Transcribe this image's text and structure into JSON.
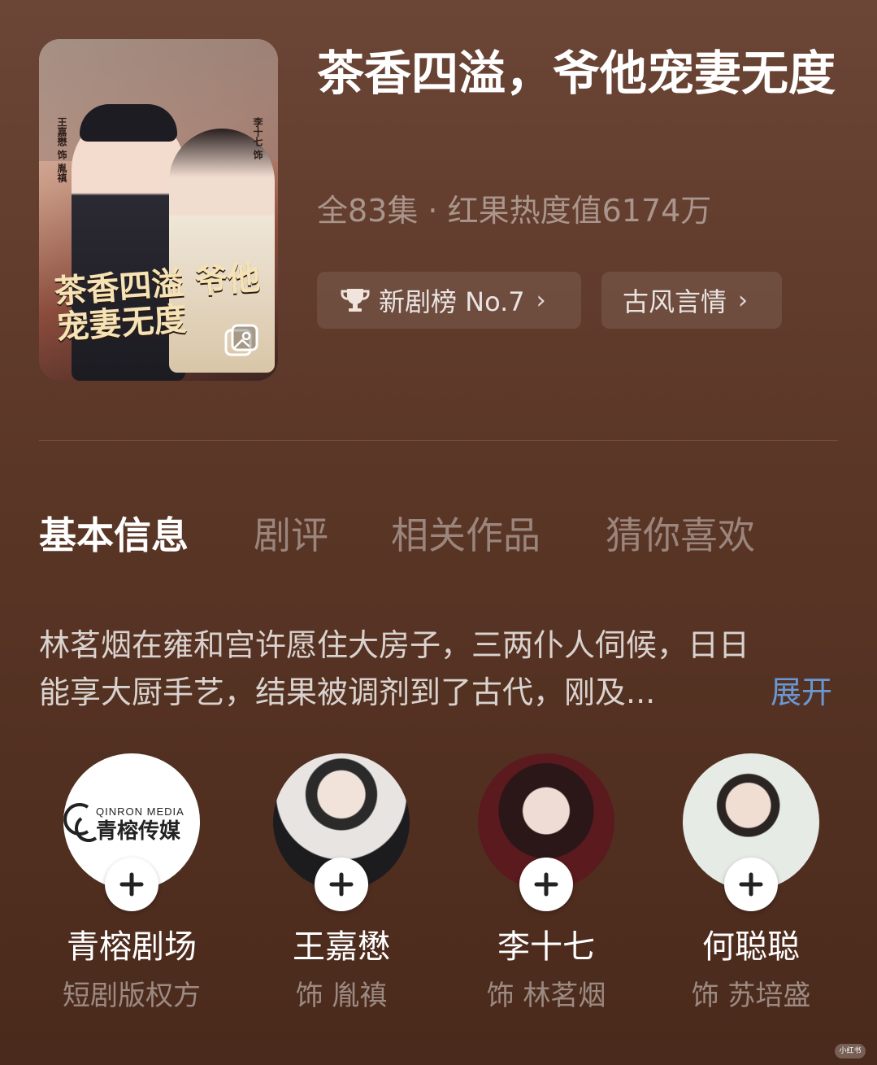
{
  "drama": {
    "title": "茶香四溢，爷他宠妻无度",
    "meta": "全83集 · 红果热度值6174万",
    "rank_chip": "新剧榜 No.7",
    "genre_chip": "古风言情"
  },
  "poster": {
    "title_art": "茶香四溢 爷他宠妻无度",
    "cast_left": "王嘉懋 饰 胤禛",
    "cast_right": "李十七 饰"
  },
  "tabs": [
    {
      "label": "基本信息",
      "active": true
    },
    {
      "label": "剧评",
      "active": false
    },
    {
      "label": "相关作品",
      "active": false
    },
    {
      "label": "猜你喜欢",
      "active": false
    }
  ],
  "synopsis": {
    "line1": "林茗烟在雍和宫许愿住大房子，三两仆人伺候，日日",
    "line2": "能享大厨手艺，结果被调剂到了古代，刚及...",
    "expand_label": "展开"
  },
  "people": [
    {
      "name": "青榕剧场",
      "role": "短剧版权方",
      "logo_text_en": "QINRON MEDIA",
      "logo_text_cn": "青榕传媒"
    },
    {
      "name": "王嘉懋",
      "role": "饰 胤禛"
    },
    {
      "name": "李十七",
      "role": "饰 林茗烟"
    },
    {
      "name": "何聪聪",
      "role": "饰 苏培盛"
    }
  ],
  "watermark": "小红书",
  "colors": {
    "accent_link": "#6a98d4",
    "background_top": "#6b4535",
    "background_bottom": "#4a2a1c"
  },
  "icons": [
    "trophy-icon",
    "chevron-right-icon",
    "gallery-icon",
    "plus-icon"
  ]
}
